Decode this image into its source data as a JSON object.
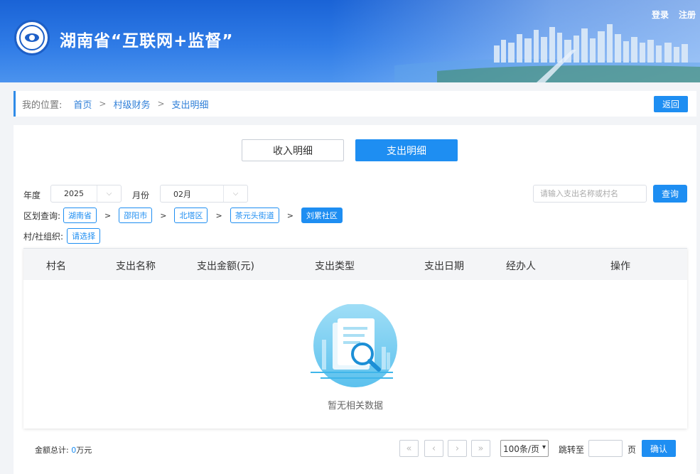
{
  "header": {
    "title": "湖南省“互联网+监督”",
    "links": {
      "login": "登录",
      "register": "注册"
    }
  },
  "breadcrumb": {
    "prefix": "我的位置:",
    "items": [
      "首页",
      "村级财务",
      "支出明细"
    ],
    "separator": ">",
    "back_label": "返回"
  },
  "tabs": [
    {
      "label": "收入明细",
      "active": false
    },
    {
      "label": "支出明细",
      "active": true
    }
  ],
  "filters": {
    "year_label": "年度",
    "year_value": "2025",
    "month_label": "月份",
    "month_value": "02月",
    "search_placeholder": "请输入支出名称或村名",
    "query_label": "查询",
    "region_label": "区划查询:",
    "region_path": [
      "湖南省",
      "邵阳市",
      "北塔区",
      "茶元头街道",
      "刘累社区"
    ],
    "region_separator": ">",
    "org_label": "村/社组织:",
    "org_button": "请选择"
  },
  "table": {
    "columns": [
      "村名",
      "支出名称",
      "支出金额(元)",
      "支出类型",
      "支出日期",
      "经办人",
      "操作"
    ],
    "rows": [],
    "empty_text": "暂无相关数据"
  },
  "footer": {
    "total_label": "金额总计:",
    "total_value": "0",
    "total_unit": "万元",
    "pager": {
      "first": "«",
      "prev": "‹",
      "next": "›",
      "last": "»",
      "page_size": "100条/页",
      "jump_label": "跳转至",
      "page_unit": "页",
      "confirm_label": "确认"
    }
  },
  "colors": {
    "accent": "#1e8ef2",
    "header": "#1a63d6"
  }
}
